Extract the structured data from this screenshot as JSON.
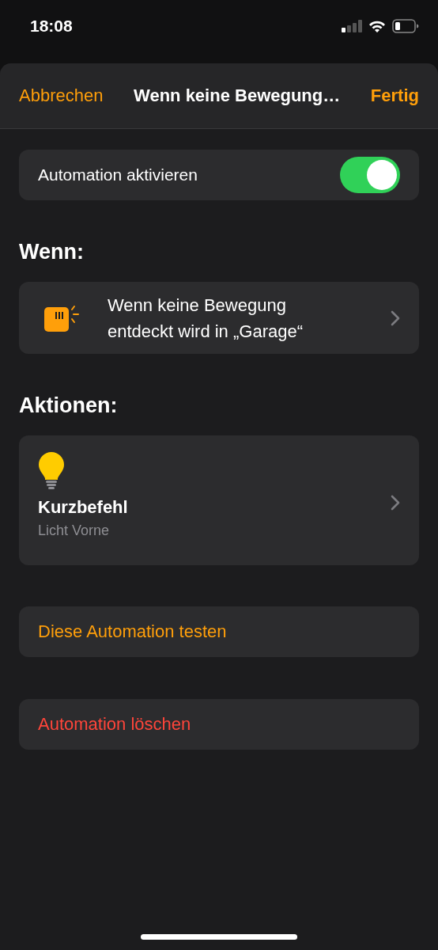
{
  "status_bar": {
    "time": "18:08"
  },
  "nav": {
    "cancel": "Abbrechen",
    "title": "Wenn keine Bewegung…",
    "done": "Fertig"
  },
  "enable": {
    "label": "Automation aktivieren",
    "on": true
  },
  "sections": [
    {
      "kind": "trigger",
      "heading": "Wenn:",
      "text": "Wenn keine Bewegung entdeckt wird in „Garage“"
    },
    {
      "kind": "action",
      "heading": "Aktionen:",
      "title": "Kurzbefehl",
      "subtitle": "Licht Vorne"
    }
  ],
  "buttons": [
    {
      "kind": "test",
      "label": "Diese Automation testen"
    },
    {
      "kind": "delete",
      "label": "Automation löschen"
    }
  ]
}
